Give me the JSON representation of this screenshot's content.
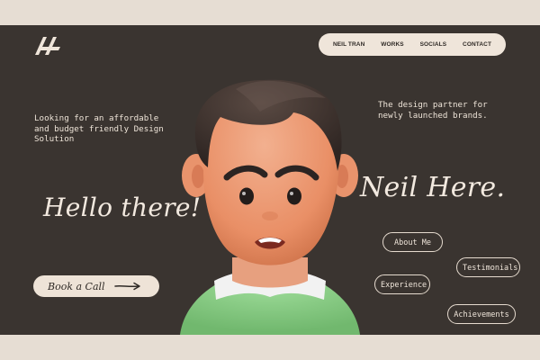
{
  "nav": {
    "items": [
      "NEIL TRAN",
      "WORKS",
      "SOCIALS",
      "CONTACT"
    ]
  },
  "hero": {
    "intro_text": "Looking for an affordable and budget friendly Design Solution",
    "partner_text": "The design partner for newly launched brands.",
    "greeting": "Hello there!",
    "name_script": "Neil Here.",
    "cta_label": "Book a Call",
    "pills": [
      "About Me",
      "Testimonials",
      "Experience",
      "Achievements"
    ]
  },
  "icons": {
    "logo": "slash-logo-icon",
    "arrow": "arrow-right-icon",
    "avatar": "3d-avatar-illustration"
  },
  "colors": {
    "background": "#3a3430",
    "page": "#e6ddd3",
    "accent": "#efe5da",
    "text": "#2f2a26",
    "shirt": "#89cf86"
  }
}
